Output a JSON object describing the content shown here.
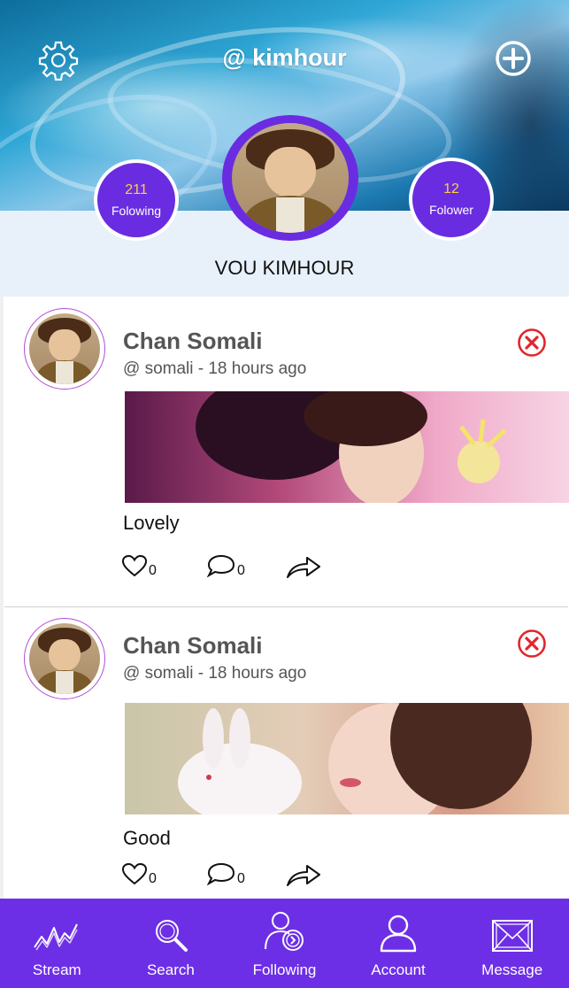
{
  "header": {
    "handle": "@ kimhour",
    "settings_icon": "gear-icon",
    "add_icon": "plus-circle-icon",
    "following": {
      "count": "211",
      "label": "Folowing"
    },
    "followers": {
      "count": "12",
      "label": "Folower"
    },
    "full_name": "VOU KIMHOUR"
  },
  "posts": [
    {
      "name": "Chan Somali",
      "meta": "@ somali - 18 hours ago",
      "text": "Lovely",
      "likes": "0",
      "comments": "0"
    },
    {
      "name": "Chan Somali",
      "meta": "@ somali - 18 hours ago",
      "text": "Good",
      "likes": "0",
      "comments": "0"
    }
  ],
  "nav": {
    "items": [
      {
        "label": "Stream",
        "icon": "stream-wave-icon"
      },
      {
        "label": "Search",
        "icon": "search-icon"
      },
      {
        "label": "Following",
        "icon": "following-user-icon"
      },
      {
        "label": "Account",
        "icon": "account-user-icon"
      },
      {
        "label": "Message",
        "icon": "envelope-icon"
      }
    ]
  },
  "colors": {
    "accent": "#6d2fe6",
    "count": "#ffd23c",
    "remove": "#e0262c"
  }
}
